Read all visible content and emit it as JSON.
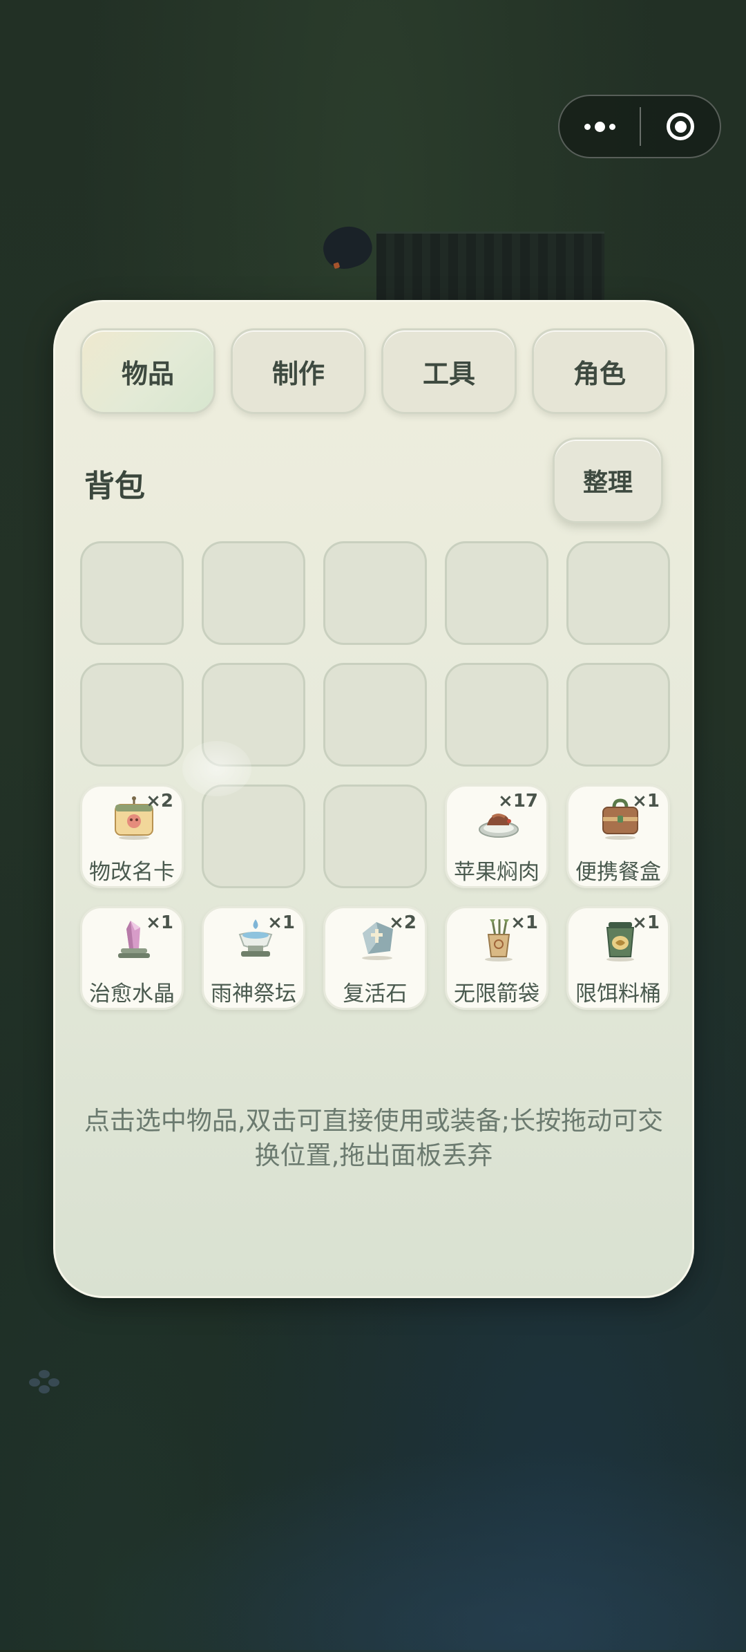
{
  "capsule": {
    "more_icon": "more-dots-icon",
    "close_icon": "target-circle-icon"
  },
  "tabs": [
    {
      "label": "物品",
      "active": true
    },
    {
      "label": "制作",
      "active": false
    },
    {
      "label": "工具",
      "active": false
    },
    {
      "label": "角色",
      "active": false
    }
  ],
  "inventory": {
    "title": "背包",
    "sort_label": "整理",
    "slots": [
      {
        "empty": true
      },
      {
        "empty": true
      },
      {
        "empty": true
      },
      {
        "empty": true
      },
      {
        "empty": true
      },
      {
        "empty": true
      },
      {
        "empty": true
      },
      {
        "empty": true
      },
      {
        "empty": true
      },
      {
        "empty": true
      },
      {
        "name": "物改名卡",
        "count": "×2",
        "icon": "rename-card-icon"
      },
      {
        "empty": true
      },
      {
        "empty": true
      },
      {
        "name": "苹果焖肉",
        "count": "×17",
        "icon": "braised-meat-icon"
      },
      {
        "name": "便携餐盒",
        "count": "×1",
        "icon": "lunch-box-icon"
      },
      {
        "name": "治愈水晶",
        "count": "×1",
        "icon": "healing-crystal-icon"
      },
      {
        "name": "雨神祭坛",
        "count": "×1",
        "icon": "rain-altar-icon"
      },
      {
        "name": "复活石",
        "count": "×2",
        "icon": "revive-stone-icon"
      },
      {
        "name": "无限箭袋",
        "count": "×1",
        "icon": "quiver-icon"
      },
      {
        "name": "限饵料桶",
        "count": "×1",
        "icon": "bait-bucket-icon"
      }
    ]
  },
  "hint": "点击选中物品,双击可直接使用或装备;长按拖动可交换位置,拖出面板丢弃"
}
